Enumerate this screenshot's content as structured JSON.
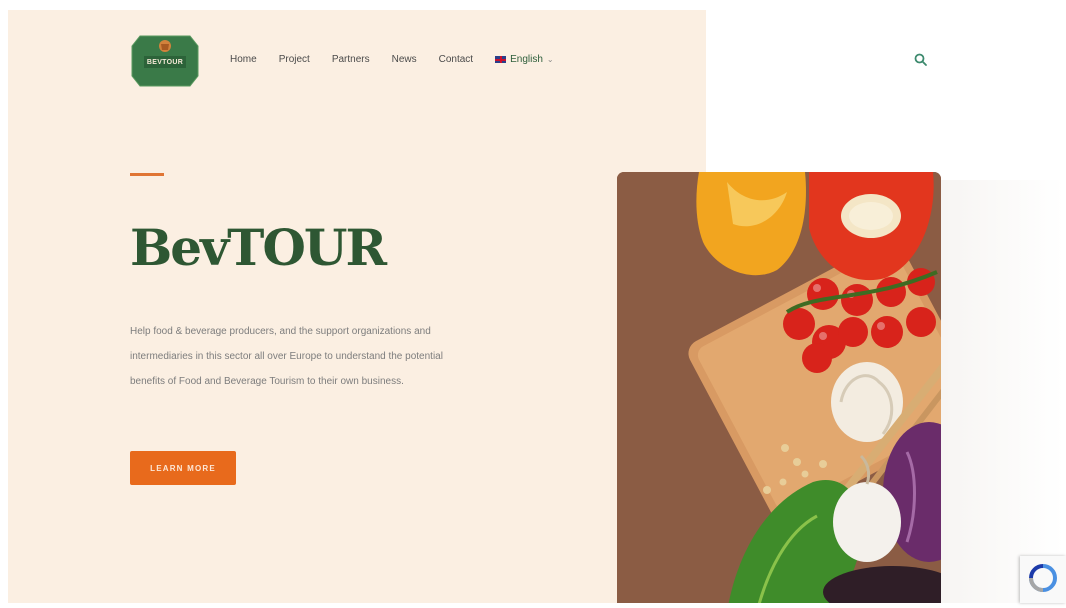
{
  "header": {
    "logo_text": "BEVTOUR",
    "nav": [
      {
        "label": "Home"
      },
      {
        "label": "Project"
      },
      {
        "label": "Partners"
      },
      {
        "label": "News"
      },
      {
        "label": "Contact"
      }
    ],
    "language": {
      "label": "English",
      "flag_icon": "uk-flag-icon",
      "chevron_icon": "chevron-down-icon"
    },
    "search_icon": "search-icon"
  },
  "hero": {
    "title": "BevTOUR",
    "description": "Help food & beverage producers, and the support organizations and intermediaries in this sector all over Europe to understand the potential benefits of Food and Beverage Tourism to their own business.",
    "cta_label": "LEARN MORE"
  },
  "image": {
    "subject": "vegetables-on-cutting-board"
  },
  "colors": {
    "background": "#fbefe2",
    "brand_green": "#2e5733",
    "accent_orange": "#e86a1c",
    "logo_green": "#3a7a48"
  },
  "recaptcha_icon": "recaptcha-icon"
}
